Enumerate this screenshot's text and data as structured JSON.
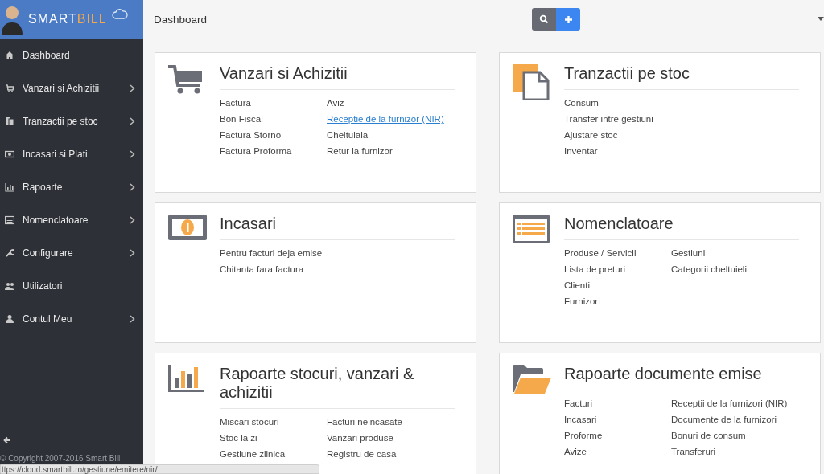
{
  "logo": {
    "word_1": "SMART",
    "word_2": "BILL"
  },
  "header": {
    "title": "Dashboard"
  },
  "sidebar": {
    "items": [
      {
        "label": "Dashboard",
        "submenu": false
      },
      {
        "label": "Vanzari si Achizitii",
        "submenu": true
      },
      {
        "label": "Tranzactii pe stoc",
        "submenu": true
      },
      {
        "label": "Incasari si Plati",
        "submenu": true
      },
      {
        "label": "Rapoarte",
        "submenu": true
      },
      {
        "label": "Nomenclatoare",
        "submenu": true
      },
      {
        "label": "Configurare",
        "submenu": true
      },
      {
        "label": "Utilizatori",
        "submenu": false
      },
      {
        "label": "Contul Meu",
        "submenu": true
      }
    ],
    "copyright": "© Copyright 2007-2016 Smart Bill"
  },
  "cards": [
    {
      "title": "Vanzari si Achizitii",
      "columns": [
        [
          {
            "label": "Factura",
            "hovered": false
          },
          {
            "label": "Bon Fiscal",
            "hovered": false
          },
          {
            "label": "Factura Storno",
            "hovered": false
          },
          {
            "label": "Factura Proforma",
            "hovered": false
          }
        ],
        [
          {
            "label": "Aviz",
            "hovered": false
          },
          {
            "label": "Receptie de la furnizor (NIR)",
            "hovered": true
          },
          {
            "label": "Cheltuiala",
            "hovered": false
          },
          {
            "label": "Retur la furnizor",
            "hovered": false
          }
        ]
      ]
    },
    {
      "title": "Tranzactii pe stoc",
      "columns": [
        [
          {
            "label": "Consum",
            "hovered": false
          },
          {
            "label": "Transfer intre gestiuni",
            "hovered": false
          },
          {
            "label": "Ajustare stoc",
            "hovered": false
          },
          {
            "label": "Inventar",
            "hovered": false
          }
        ]
      ]
    },
    {
      "title": "Incasari",
      "columns": [
        [
          {
            "label": "Pentru facturi deja emise",
            "hovered": false
          },
          {
            "label": "Chitanta fara factura",
            "hovered": false
          }
        ]
      ]
    },
    {
      "title": "Nomenclatoare",
      "columns": [
        [
          {
            "label": "Produse / Servicii",
            "hovered": false
          },
          {
            "label": "Lista de preturi",
            "hovered": false
          },
          {
            "label": "Clienti",
            "hovered": false
          },
          {
            "label": "Furnizori",
            "hovered": false
          }
        ],
        [
          {
            "label": "Gestiuni",
            "hovered": false
          },
          {
            "label": "Categorii cheltuieli",
            "hovered": false
          }
        ]
      ]
    },
    {
      "title": "Rapoarte stocuri, vanzari & achizitii",
      "columns": [
        [
          {
            "label": "Miscari stocuri",
            "hovered": false
          },
          {
            "label": "Stoc la zi",
            "hovered": false
          },
          {
            "label": "Gestiune zilnica",
            "hovered": false
          }
        ],
        [
          {
            "label": "Facturi neincasate",
            "hovered": false
          },
          {
            "label": "Vanzari produse",
            "hovered": false
          },
          {
            "label": "Registru de casa",
            "hovered": false
          }
        ]
      ]
    },
    {
      "title": "Rapoarte documente emise",
      "columns": [
        [
          {
            "label": "Facturi",
            "hovered": false
          },
          {
            "label": "Incasari",
            "hovered": false
          },
          {
            "label": "Proforme",
            "hovered": false
          },
          {
            "label": "Avize",
            "hovered": false
          }
        ],
        [
          {
            "label": "Receptii de la furnizori (NIR)",
            "hovered": false
          },
          {
            "label": "Documente de la furnizori",
            "hovered": false
          },
          {
            "label": "Bonuri de consum",
            "hovered": false
          },
          {
            "label": "Transferuri",
            "hovered": false
          }
        ]
      ]
    }
  ],
  "status_bar": {
    "url": "ttps://cloud.smartbill.ro/gestiune/emitere/nir/"
  }
}
